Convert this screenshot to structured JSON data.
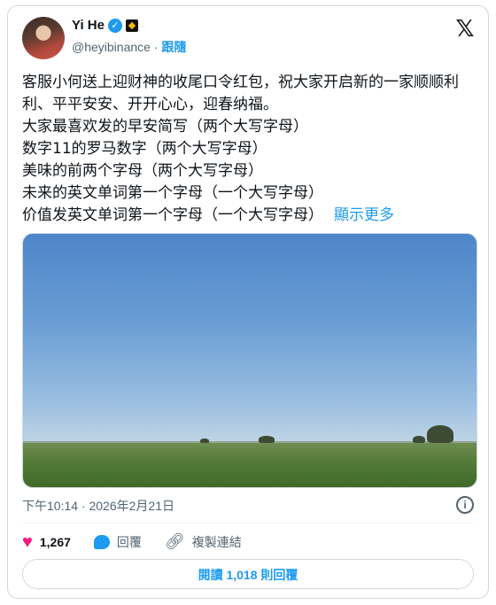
{
  "author": {
    "display_name": "Yi He",
    "handle": "@heyibinance",
    "separator": "·",
    "follow_label": "跟隨",
    "verified_icon": "verified-badge-icon",
    "affiliate_icon": "binance-affiliate-icon"
  },
  "brand": {
    "logo_icon": "x-logo-icon",
    "logo_glyph": "𝕏"
  },
  "tweet": {
    "lines": [
      "客服小何送上迎财神的收尾口令红包，祝大家开启新的一家顺顺利利、平平安安、开开心心，迎春纳福。",
      "大家最喜欢发的早安简写（两个大写字母）",
      "数字11的罗马数字（两个大写字母）",
      "美味的前两个字母（两个大写字母）",
      "未来的英文单词第一个字母（一个大写字母）",
      "价值发英文单词第一个字母（一个大写字母）"
    ],
    "show_more": "顯示更多",
    "timestamp": "下午10:14 · 2026年2月21日"
  },
  "actions": {
    "like_count": "1,267",
    "reply_label": "回覆",
    "copy_link_label": "複製連結"
  },
  "read_replies_label": "閱讀 1,018 則回覆",
  "colors": {
    "accent": "#1d9bf0",
    "like": "#f91880",
    "text": "#0f1419",
    "muted": "#536471",
    "border": "#cfd9de"
  }
}
